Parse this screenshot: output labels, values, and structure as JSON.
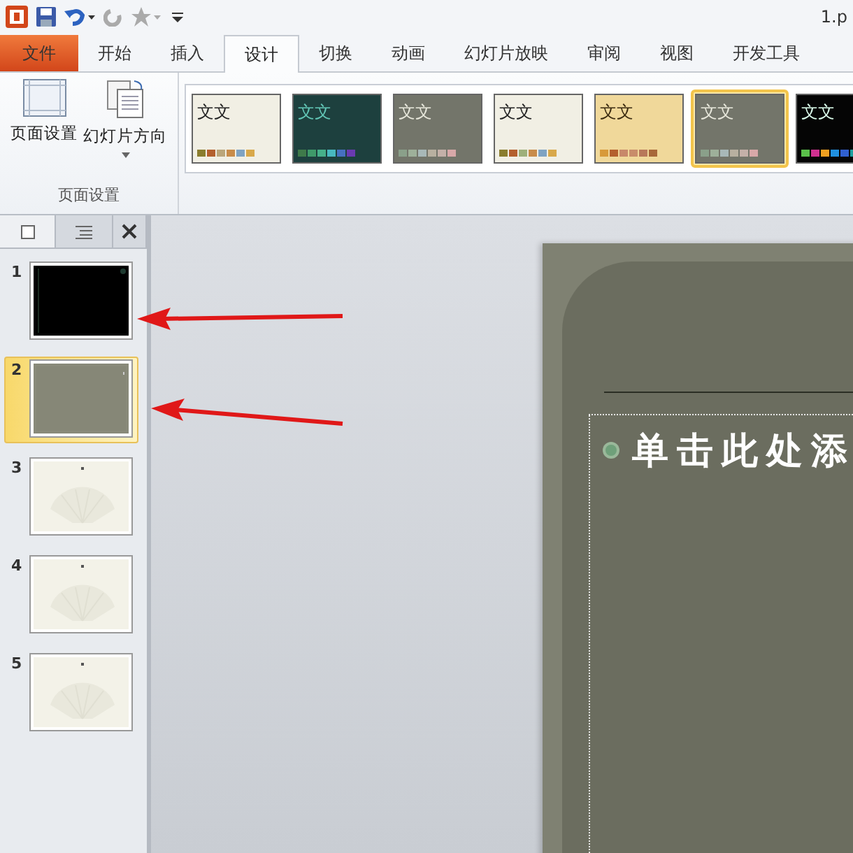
{
  "title_bar": {
    "title": "1.p"
  },
  "tabs": [
    {
      "label": "文件",
      "kind": "file",
      "selected": false
    },
    {
      "label": "开始",
      "kind": "tab",
      "selected": false
    },
    {
      "label": "插入",
      "kind": "tab",
      "selected": false
    },
    {
      "label": "设计",
      "kind": "tab",
      "selected": true
    },
    {
      "label": "切换",
      "kind": "tab",
      "selected": false
    },
    {
      "label": "动画",
      "kind": "tab",
      "selected": false
    },
    {
      "label": "幻灯片放映",
      "kind": "tab",
      "selected": false
    },
    {
      "label": "审阅",
      "kind": "tab",
      "selected": false
    },
    {
      "label": "视图",
      "kind": "tab",
      "selected": false
    },
    {
      "label": "开发工具",
      "kind": "tab",
      "selected": false
    }
  ],
  "ribbon": {
    "group": {
      "label": "页面设置",
      "buttons": [
        {
          "label": "页面设置",
          "kind": "page"
        },
        {
          "label": "幻灯片方向",
          "kind": "orientation"
        }
      ]
    },
    "themes": [
      {
        "label": "文文",
        "selected": false
      },
      {
        "label": "文文",
        "selected": false
      },
      {
        "label": "文文",
        "selected": false
      },
      {
        "label": "文文",
        "selected": false
      },
      {
        "label": "文文",
        "selected": false
      },
      {
        "label": "文文",
        "selected": true
      },
      {
        "label": "文文",
        "selected": false
      }
    ]
  },
  "slides": [
    {
      "number": "1",
      "kind": "dark",
      "selected": false
    },
    {
      "number": "2",
      "kind": "grey",
      "selected": true
    },
    {
      "number": "3",
      "kind": "fan",
      "selected": false
    },
    {
      "number": "4",
      "kind": "fan",
      "selected": false
    },
    {
      "number": "5",
      "kind": "fan",
      "selected": false
    }
  ],
  "slide": {
    "bullet_text": "单击此处添"
  }
}
